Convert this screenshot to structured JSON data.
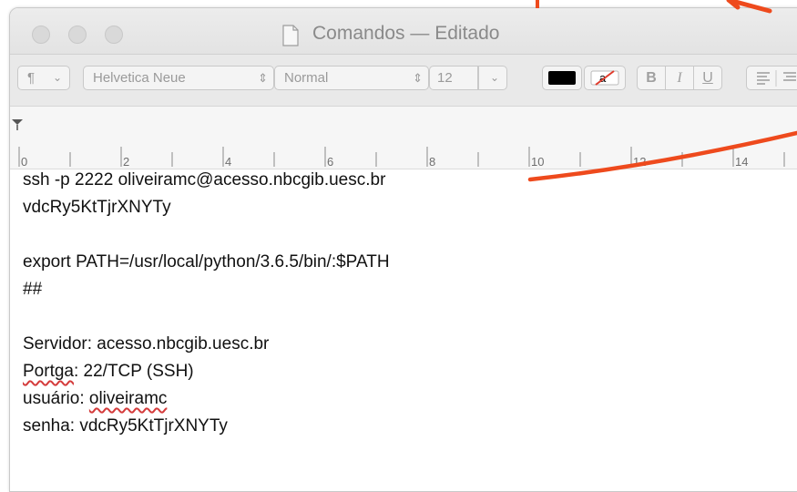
{
  "window": {
    "title": "Comandos — Editado"
  },
  "format_bar": {
    "paragraph_style": "¶",
    "font_family": "Helvetica Neue",
    "font_style": "Normal",
    "font_size": "12",
    "text_color": "#000000",
    "bold_label": "B",
    "italic_label": "I",
    "underline_label": "U"
  },
  "ruler": {
    "marks": [
      "0",
      "2",
      "4",
      "6",
      "8",
      "10",
      "12",
      "14"
    ]
  },
  "document": {
    "lines": [
      "ssh -p 2222 oliveiramc@acesso.nbcgib.uesc.br",
      "vdcRy5KtTjrXNYTy",
      "",
      "export PATH=/usr/local/python/3.6.5/bin/:$PATH",
      "##",
      "",
      "Servidor: acesso.nbcgib.uesc.br"
    ],
    "porta_word": "Portga",
    "porta_rest": ": 22/TCP (SSH)",
    "usuario_label": "usuário: ",
    "usuario_value": "oliveiramc",
    "senha_line": "senha: vdcRy5KtTjrXNYTy"
  },
  "colors": {
    "annotation": "#ee4a1d",
    "spellcheck": "#d43c3c"
  }
}
